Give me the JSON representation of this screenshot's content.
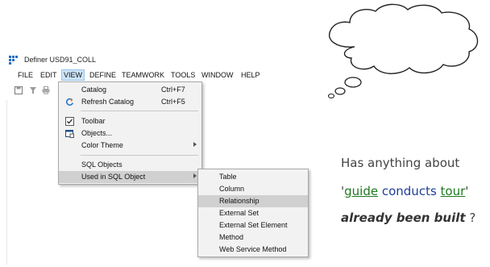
{
  "window": {
    "title": "Definer USD91_COLL"
  },
  "menubar": [
    "FILE",
    "EDIT",
    "VIEW",
    "DEFINE",
    "TEAMWORK",
    "TOOLS",
    "WINDOW",
    "HELP"
  ],
  "toolbar_icons": [
    "save-icon",
    "filter-icon",
    "print-icon"
  ],
  "view_menu": {
    "items": [
      {
        "label": "Catalog",
        "shortcut": "Ctrl+F7",
        "icon": ""
      },
      {
        "label": "Refresh Catalog",
        "shortcut": "Ctrl+F5",
        "icon": "refresh-icon"
      },
      {
        "label": "Toolbar",
        "shortcut": "",
        "icon": "checkbox-checked-icon"
      },
      {
        "label": "Objects...",
        "shortcut": "",
        "icon": "objects-window-icon"
      },
      {
        "label": "Color Theme",
        "shortcut": "",
        "icon": "",
        "submenu": true
      },
      {
        "label": "SQL Objects",
        "shortcut": "",
        "icon": ""
      },
      {
        "label": "Used in SQL Object",
        "shortcut": "",
        "icon": "",
        "submenu": true,
        "highlighted": true
      }
    ]
  },
  "sql_submenu": {
    "items": [
      {
        "label": "Table"
      },
      {
        "label": "Column"
      },
      {
        "label": "Relationship",
        "highlighted": true
      },
      {
        "label": "External Set"
      },
      {
        "label": "External Set Element"
      },
      {
        "label": "Method"
      },
      {
        "label": "Web Service Method"
      }
    ]
  },
  "note": {
    "line1": "Has anything about",
    "quote_open": "'",
    "word1": "guide",
    "word2": "conducts",
    "word3": "tour",
    "quote_close": "'",
    "line3_bold": "already been built",
    "line3_end": " ?"
  },
  "colors": {
    "highlight": "#d0d0d0",
    "menu_bg": "#f2f2f2",
    "green": "#1e7a1e",
    "blue": "#1f3f9a"
  }
}
